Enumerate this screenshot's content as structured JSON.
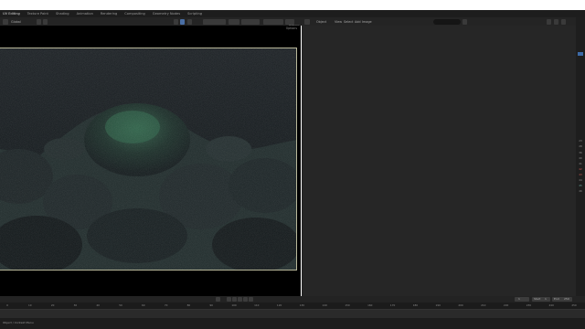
{
  "menu": {
    "tabs": [
      "UV Editing",
      "Texture Paint",
      "Shading",
      "Animation",
      "Rendering",
      "Compositing",
      "Geometry Nodes",
      "Scripting"
    ],
    "active_index": 0
  },
  "header": {
    "viewport_items": [
      "Global",
      "Options"
    ],
    "editor_items": [
      "Object",
      "View",
      "Select",
      "Add",
      "Image"
    ]
  },
  "viewport": {
    "label": "Options"
  },
  "right_strip": {
    "items": [
      "23",
      "28",
      "36",
      "40",
      "41",
      "42",
      "43",
      "44",
      "45",
      "46"
    ]
  },
  "timeline": {
    "ticks": [
      "0",
      "10",
      "20",
      "30",
      "40",
      "50",
      "60",
      "70",
      "80",
      "90",
      "100",
      "110",
      "120",
      "130",
      "140",
      "150",
      "160",
      "170",
      "180",
      "190",
      "200",
      "210",
      "220",
      "230",
      "240",
      "250"
    ],
    "start_label": "Start",
    "start_value": "1",
    "end_label": "End",
    "end_value": "250",
    "current_frame": "1"
  },
  "status": {
    "text": "Object / Context Menu"
  },
  "colors": {
    "selection_blue": "#3d6aa6",
    "frame_border": "#b9b89a",
    "accent_red": "#c95b52",
    "accent_teal": "#6aa89c"
  }
}
